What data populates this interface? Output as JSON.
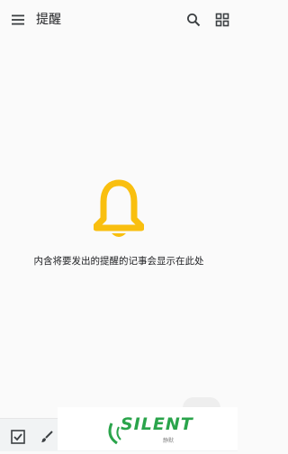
{
  "header": {
    "title": "提醒",
    "menu_icon": "menu-icon",
    "search_icon": "search-icon",
    "grid_icon": "grid-view-icon"
  },
  "empty_state": {
    "icon": "bell-icon",
    "icon_color": "#f9bf0f",
    "message": "内含将要发出的提醒的记事会显示在此处"
  },
  "bottom_bar": {
    "checkbox_icon": "checkbox-icon",
    "brush_icon": "brush-icon"
  },
  "watermark": {
    "text": "SILENT",
    "sub": "静默"
  }
}
